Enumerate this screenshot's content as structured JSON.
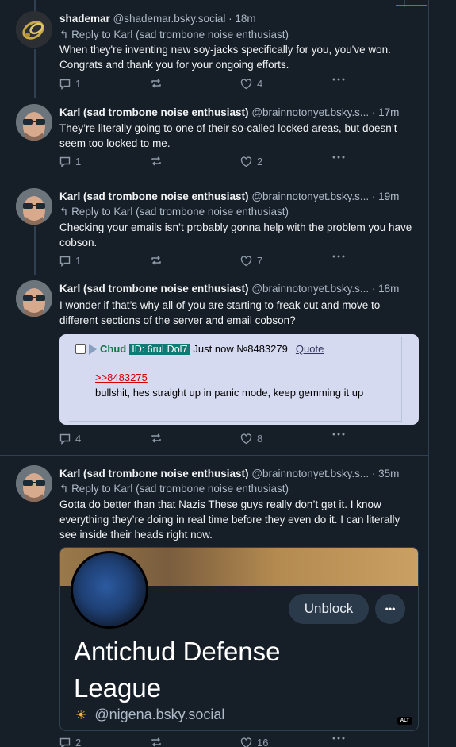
{
  "posts": [
    {
      "name": "shademar",
      "handle": "@shademar.bsky.social",
      "time": "· 18m",
      "reply_to": "Reply to Karl (sad trombone noise enthusiast)",
      "text": "When they're inventing new soy-jacks specifically for you, you've won. Congrats and thank you for your ongoing efforts.",
      "replies": "1",
      "reposts": "",
      "likes": "4"
    },
    {
      "name": "Karl (sad trombone noise enthusiast)",
      "handle": "@brainnotonyet.bsky.s...",
      "time": "· 17m",
      "reply_to": "",
      "text": "They’re literally going to one of their so-called locked areas, but doesn’t seem too locked to me.",
      "replies": "1",
      "reposts": "",
      "likes": "2"
    },
    {
      "name": "Karl (sad trombone noise enthusiast)",
      "handle": "@brainnotonyet.bsky.s...",
      "time": "· 19m",
      "reply_to": "Reply to Karl (sad trombone noise enthusiast)",
      "text": "Checking your emails isn’t probably gonna help with the problem you have cobson.",
      "replies": "1",
      "reposts": "",
      "likes": "7"
    },
    {
      "name": "Karl (sad trombone noise enthusiast)",
      "handle": "@brainnotonyet.bsky.s...",
      "time": "· 18m",
      "reply_to": "",
      "text": "I wonder if that’s why all of you are starting to freak out and move to different sections of the server and email cobson?",
      "replies": "4",
      "reposts": "",
      "likes": "8"
    },
    {
      "name": "Karl (sad trombone noise enthusiast)",
      "handle": "@brainnotonyet.bsky.s...",
      "time": "· 35m",
      "reply_to": "Reply to Karl (sad trombone noise enthusiast)",
      "text": "Gotta do better than that Nazis These guys really don’t get it. I know everything they’re doing in real time before they even do it.  I can literally see inside their heads right now.",
      "replies": "2",
      "reposts": "",
      "likes": "16"
    }
  ],
  "chan_embed": {
    "name": "Chud",
    "id": "ID: 6ruLDol7",
    "time": "Just now №8483279",
    "quote": "Quote",
    "ref": ">>8483275",
    "body": "bullshit, hes straight up in panic mode, keep gemming it up"
  },
  "profile_embed": {
    "unblock": "Unblock",
    "more": "•••",
    "title_line1": "Antichud Defense",
    "title_line2": "League",
    "handle": "@nigena.bsky.social",
    "alt": "ALT"
  },
  "colors": {
    "background": "#161e27",
    "border": "#2e4052",
    "muted": "#aebbc9",
    "chan_id_bg": "#117a74",
    "chan_name": "#117743",
    "chan_link": "#d00000"
  }
}
